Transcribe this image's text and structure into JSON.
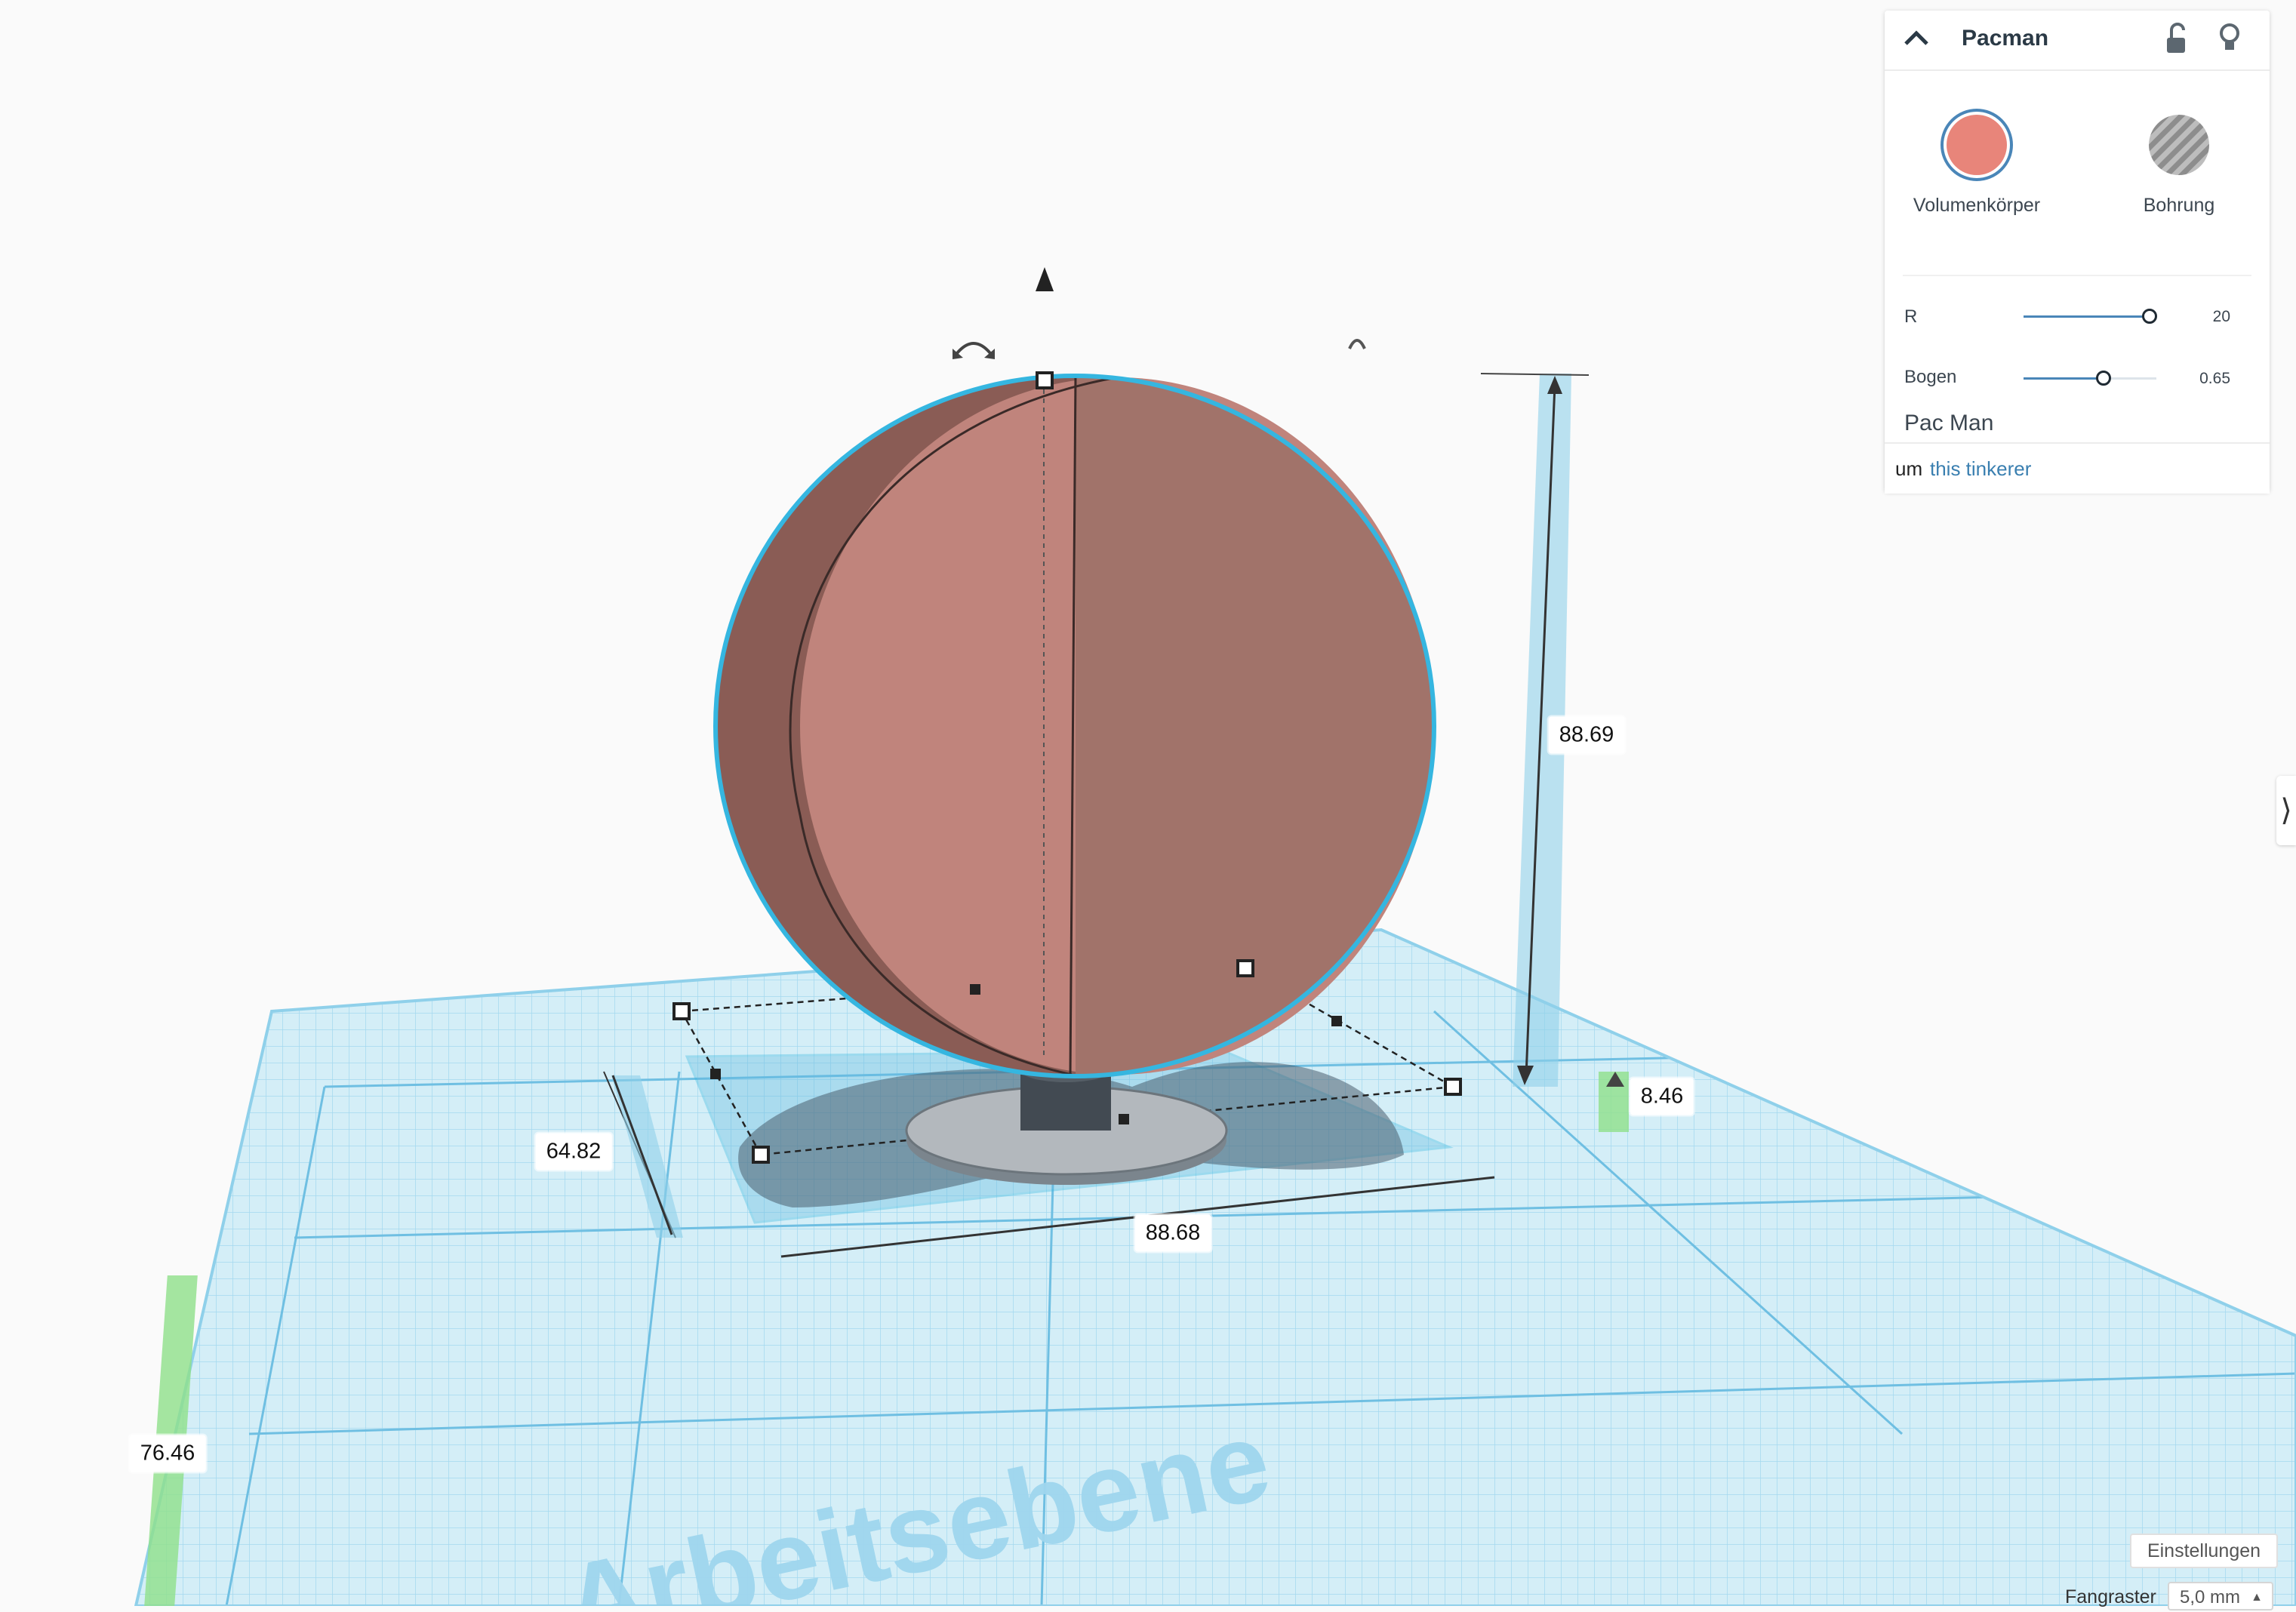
{
  "inspector": {
    "title": "Pacman",
    "collapse_icon": "chevron-up-icon",
    "lock_icon": "unlock-icon",
    "visibility_icon": "lightbulb-icon",
    "types": [
      {
        "label": "Volumenkörper",
        "color": "#e8857a",
        "selected": true
      },
      {
        "label": "Bohrung",
        "color": "#9a9a9a",
        "selected": false
      }
    ],
    "params": [
      {
        "label": "R",
        "value": "20",
        "level": 0.95
      },
      {
        "label": "Bogen",
        "value": "0.65",
        "level": 0.6
      }
    ],
    "shape_name": "Pac Man",
    "footer_prefix": "um",
    "footer_link": "this tinkerer"
  },
  "dimensions": {
    "height": "88.69",
    "width": "88.68",
    "depth": "64.82",
    "elevation": "8.46",
    "offset": "76.46"
  },
  "workplane_text": "Arbeitsebene",
  "colors": {
    "shape_light": "#c0847c",
    "shape_dark": "#a1736a",
    "shape_side": "#8a5c55",
    "selection": "#35b6e0",
    "grid": "#8fd0ea",
    "accent_link": "#3a7fb0"
  },
  "bottom_bar": {
    "settings_label": "Einstellungen",
    "snap_label": "Fangraster",
    "snap_value": "5,0 mm"
  }
}
